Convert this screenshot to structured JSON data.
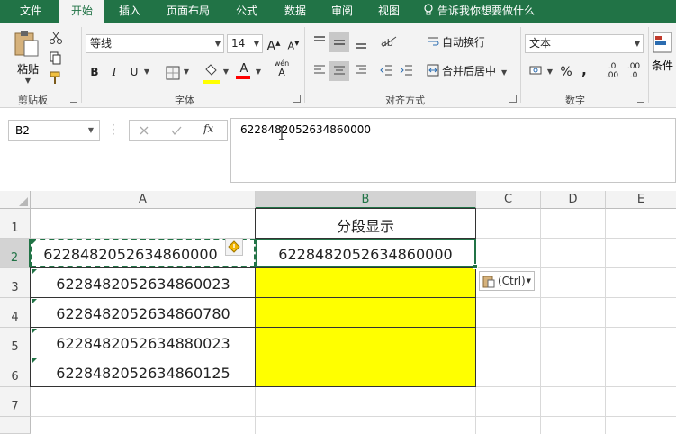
{
  "tabs": [
    {
      "label": "文件",
      "active": false
    },
    {
      "label": "开始",
      "active": true
    },
    {
      "label": "插入",
      "active": false
    },
    {
      "label": "页面布局",
      "active": false
    },
    {
      "label": "公式",
      "active": false
    },
    {
      "label": "数据",
      "active": false
    },
    {
      "label": "审阅",
      "active": false
    },
    {
      "label": "视图",
      "active": false
    }
  ],
  "tellme": "告诉我你想要做什么",
  "clipboard": {
    "paste_label": "粘贴",
    "group_label": "剪贴板"
  },
  "font": {
    "name": "等线",
    "size": "14",
    "grow": "A",
    "shrink": "A",
    "bold": "B",
    "italic": "I",
    "underline": "U",
    "phonetic": "wén",
    "group_label": "字体"
  },
  "alignment": {
    "wrap_label": "自动换行",
    "merge_label": "合并后居中",
    "group_label": "对齐方式"
  },
  "number": {
    "format": "文本",
    "percent": "%",
    "comma": ",",
    "inc_decimal": ".00",
    "dec_decimal": ".0",
    "group_label": "数字"
  },
  "styles": {
    "conditional_label": "条件"
  },
  "formula_bar": {
    "name_box": "B2",
    "fx": "fx",
    "value": "6228482052634860000"
  },
  "columns": [
    "A",
    "B",
    "C",
    "D",
    "E"
  ],
  "rows": [
    "1",
    "2",
    "3",
    "4",
    "5",
    "6",
    "7"
  ],
  "cells": {
    "B1": "分段显示",
    "A2": "6228482052634860000",
    "B2": "6228482052634860000",
    "A3": "6228482052634860023",
    "A4": "6228482052634860780",
    "A5": "6228482052634880023",
    "A6": "6228482052634860125"
  },
  "paste_options": "(Ctrl)",
  "colors": {
    "accent": "#217346",
    "highlight": "#ffff00",
    "font_color": "#ff0000"
  }
}
